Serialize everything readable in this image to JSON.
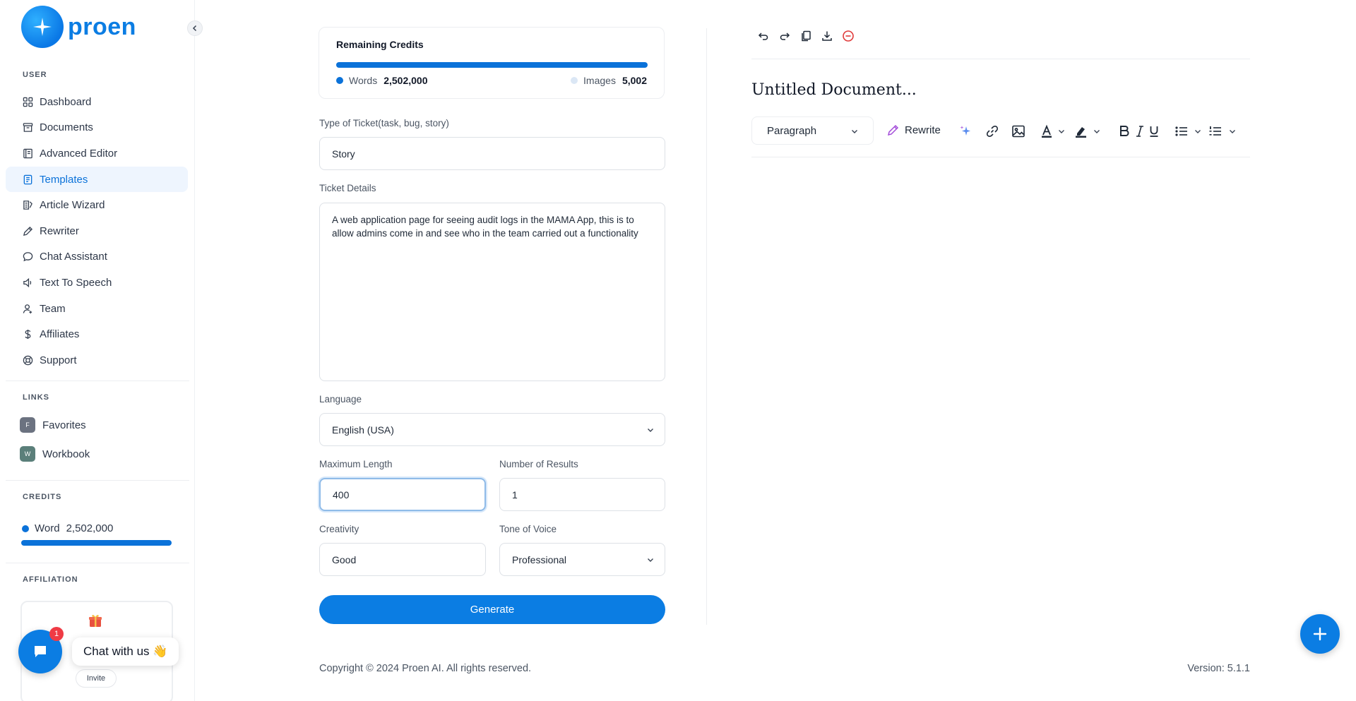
{
  "brand": {
    "name": "proen"
  },
  "sidebar": {
    "user_label": "USER",
    "items": [
      {
        "label": "Dashboard",
        "icon": "grid-icon"
      },
      {
        "label": "Documents",
        "icon": "archive-icon"
      },
      {
        "label": "Advanced Editor",
        "icon": "book-icon"
      },
      {
        "label": "Templates",
        "icon": "file-text-icon"
      },
      {
        "label": "Article Wizard",
        "icon": "article-icon"
      },
      {
        "label": "Rewriter",
        "icon": "pencil-icon"
      },
      {
        "label": "Chat Assistant",
        "icon": "chat-icon"
      },
      {
        "label": "Text To Speech",
        "icon": "speaker-icon"
      },
      {
        "label": "Team",
        "icon": "user-icon"
      },
      {
        "label": "Affiliates",
        "icon": "dollar-icon"
      },
      {
        "label": "Support",
        "icon": "lifebuoy-icon"
      }
    ],
    "active_item": "Templates",
    "links_label": "LINKS",
    "links": [
      {
        "badge": "F",
        "label": "Favorites",
        "color": "#6b7280"
      },
      {
        "badge": "W",
        "label": "Workbook",
        "color": "#5b7f7a"
      }
    ],
    "credits_label": "CREDITS",
    "credit_word_label": "Word",
    "credit_word_value": "2,502,000",
    "credit_word_fill": 1.0,
    "affiliation_label": "AFFILIATION",
    "affiliation_invite": "Invite"
  },
  "chat": {
    "badge_count": "1",
    "bubble_text": "Chat with us 👋"
  },
  "credits_card": {
    "title": "Remaining Credits",
    "words_label": "Words",
    "words_value": "2,502,000",
    "images_label": "Images",
    "images_value": "5,002",
    "fill": 1.0
  },
  "form": {
    "ticket_type_label": "Type of Ticket(task, bug, story)",
    "ticket_type_value": "Story",
    "ticket_details_label": "Ticket Details",
    "ticket_details_value": "A web application page for seeing audit logs in the MAMA App, this is to allow admins come in and see who in the team carried out a functionality",
    "language_label": "Language",
    "language_value": "English (USA)",
    "max_length_label": "Maximum Length",
    "max_length_value": "400",
    "num_results_label": "Number of Results",
    "num_results_value": "1",
    "creativity_label": "Creativity",
    "creativity_value": "Good",
    "tone_label": "Tone of Voice",
    "tone_value": "Professional",
    "generate_label": "Generate"
  },
  "editor": {
    "title": "Untitled Document...",
    "block_type": "Paragraph",
    "rewrite_label": "Rewrite"
  },
  "footer": {
    "copyright": "Copyright © 2024 Proen AI. All rights reserved.",
    "version": "Version: 5.1.1"
  },
  "colors": {
    "primary": "#0b7de3",
    "active_bg": "#eef5fe",
    "danger": "#e03a3a"
  }
}
